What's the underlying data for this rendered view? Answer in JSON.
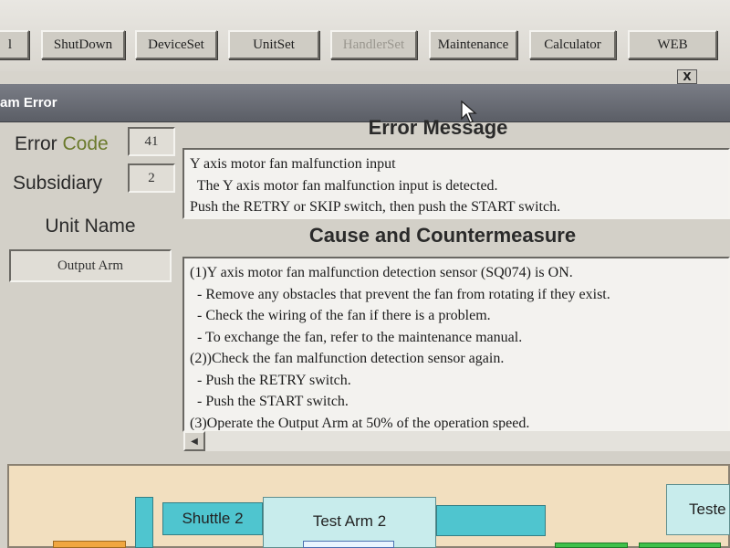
{
  "toolbar": {
    "buttons": [
      {
        "label": "l",
        "enabled": true
      },
      {
        "label": "ShutDown",
        "enabled": true
      },
      {
        "label": "DeviceSet",
        "enabled": true
      },
      {
        "label": "UnitSet",
        "enabled": true
      },
      {
        "label": "HandlerSet",
        "enabled": false
      },
      {
        "label": "Maintenance",
        "enabled": true
      },
      {
        "label": "Calculator",
        "enabled": true
      },
      {
        "label": "WEB",
        "enabled": true
      }
    ],
    "close_label": "X"
  },
  "window": {
    "title": "am Error"
  },
  "error": {
    "code_label_1": "Error",
    "code_label_2": "Code",
    "code_value": "41",
    "subsidiary_label": "Subsidiary",
    "subsidiary_value": "2",
    "unit_name_label": "Unit Name",
    "unit_name_value": "Output Arm"
  },
  "message": {
    "heading": "Error Message",
    "text": "Y axis motor fan malfunction input\n  The Y axis motor fan malfunction input is detected.\nPush the RETRY or SKIP switch, then push the START switch."
  },
  "cause": {
    "heading": "Cause and Countermeasure",
    "text": "(1)Y axis motor fan malfunction detection sensor (SQ074) is ON.\n  - Remove any obstacles that prevent the fan from rotating if they exist.\n  - Check the wiring of the fan if there is a problem.\n  - To exchange the fan, refer to the maintenance manual.\n(2))Check the fan malfunction detection sensor again.\n  - Push the RETRY switch.\n  - Push the START switch.\n(3)Operate the Output Arm at 50% of the operation speed.",
    "scroll_left_glyph": "◀"
  },
  "diagram": {
    "shuttle_label": "Shuttle 2",
    "test_arm_label": "Test Arm 2",
    "tester_label": "Teste"
  },
  "colors": {
    "cyan_block": "#4fc5cf",
    "light_cyan_block": "#c8ecec",
    "code_word_green": "#6b7a2c",
    "green_block": "#3fc04a",
    "orange_block": "#f0a640"
  }
}
